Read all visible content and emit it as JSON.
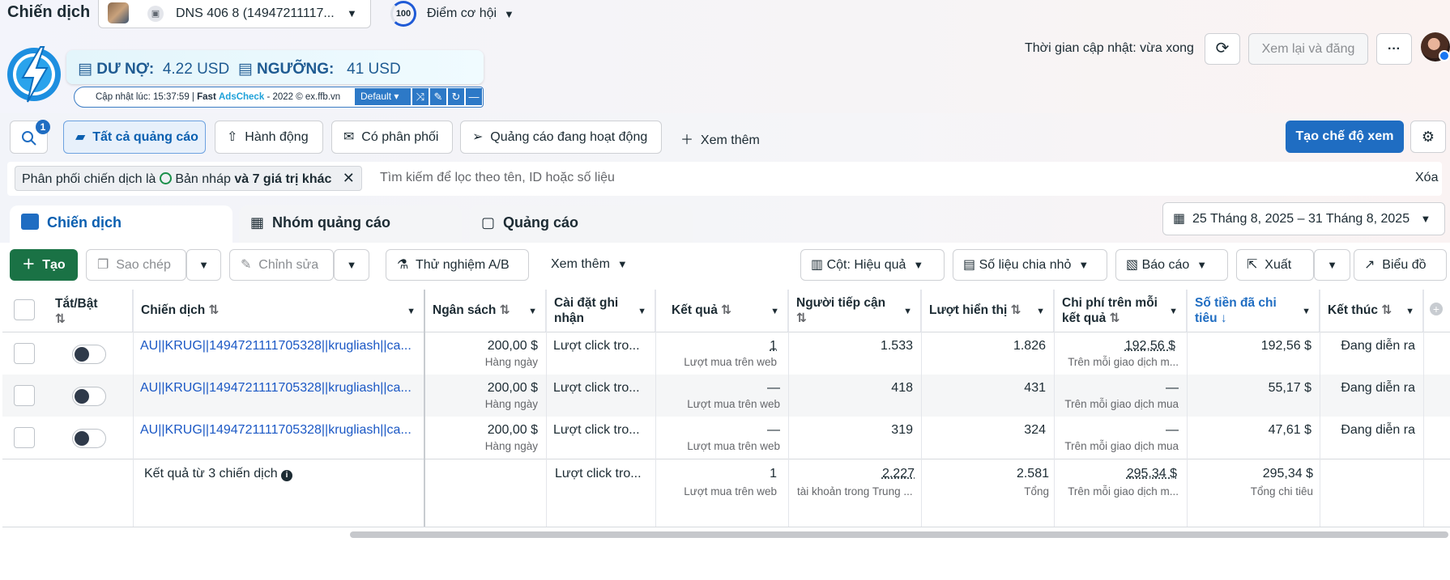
{
  "header": {
    "title": "Chiến dịch",
    "account_name": "DNS 406 8 (14947211117...",
    "opportunity_score": "100",
    "opportunity_label": "Điểm cơ hội",
    "update_time": "Thời gian cập nhật: vừa xong",
    "review_publish": "Xem lại và đăng",
    "more": "···"
  },
  "adscheck": {
    "debt_label": "DƯ NỢ:",
    "debt_value": "4.22 USD",
    "threshold_label": "NGƯỠNG:",
    "threshold_value": "41 USD",
    "updated": "Cập nhật lúc: 15:37:59 |",
    "fast": "Fast",
    "brand": "AdsCheck",
    "copyright": "- 2022 © ex.ffb.vn",
    "preset": "Default"
  },
  "filters": {
    "search_badge": "1",
    "tabs": [
      "Tất cả quảng cáo",
      "Hành động",
      "Có phân phối",
      "Quảng cáo đang hoạt động",
      "Xem thêm"
    ],
    "create_view": "Tạo chế độ xem",
    "chip_prefix": "Phân phối chiến dịch là",
    "chip_value": "Bản nháp",
    "chip_more": "và 7 giá trị khác",
    "search_placeholder": "Tìm kiếm để lọc theo tên, ID hoặc số liệu",
    "clear": "Xóa"
  },
  "levels": {
    "campaigns": "Chiến dịch",
    "adsets": "Nhóm quảng cáo",
    "ads": "Quảng cáo",
    "date_range": "25 Tháng 8, 2025 – 31 Tháng 8, 2025"
  },
  "toolbar": {
    "create": "Tạo",
    "copy": "Sao chép",
    "edit": "Chỉnh sửa",
    "ab_test": "Thử nghiệm A/B",
    "more": "Xem thêm",
    "columns": "Cột: Hiệu quả",
    "breakdown": "Số liệu chia nhỏ",
    "reports": "Báo cáo",
    "export": "Xuất",
    "charts": "Biểu đồ"
  },
  "table": {
    "headers": {
      "toggle": "Tắt/Bật",
      "campaign": "Chiến dịch",
      "budget": "Ngân sách",
      "attribution_1": "Cài đặt ghi",
      "attribution_2": "nhận",
      "results": "Kết quả",
      "reach": "Người tiếp cận",
      "impressions": "Lượt hiển thị",
      "cpr_1": "Chi phí trên mỗi",
      "cpr_2": "kết quả",
      "spent_1": "Số tiền đã chi",
      "spent_2": "tiêu",
      "ends": "Kết thúc"
    },
    "rows": [
      {
        "name": "AU||KRUG||1494721111705328||krugliash||ca...",
        "budget": "200,00 $",
        "budget_sub": "Hàng ngày",
        "attribution": "Lượt click tro...",
        "result": "1",
        "result_sub": "Lượt mua trên web",
        "reach": "1.533",
        "impressions": "1.826",
        "cpr": "192,56 $",
        "cpr_sub": "Trên mỗi giao dịch m...",
        "spent": "192,56 $",
        "ends": "Đang diễn ra"
      },
      {
        "name": "AU||KRUG||1494721111705328||krugliash||ca...",
        "budget": "200,00 $",
        "budget_sub": "Hàng ngày",
        "attribution": "Lượt click tro...",
        "result": "—",
        "result_sub": "Lượt mua trên web",
        "reach": "418",
        "impressions": "431",
        "cpr": "—",
        "cpr_sub": "Trên mỗi giao dịch mua",
        "spent": "55,17 $",
        "ends": "Đang diễn ra"
      },
      {
        "name": "AU||KRUG||1494721111705328||krugliash||ca...",
        "budget": "200,00 $",
        "budget_sub": "Hàng ngày",
        "attribution": "Lượt click tro...",
        "result": "—",
        "result_sub": "Lượt mua trên web",
        "reach": "319",
        "impressions": "324",
        "cpr": "—",
        "cpr_sub": "Trên mỗi giao dịch mua",
        "spent": "47,61 $",
        "ends": "Đang diễn ra"
      }
    ],
    "totals": {
      "label": "Kết quả từ 3 chiến dịch",
      "attribution": "Lượt click tro...",
      "result": "1",
      "result_sub": "Lượt mua trên web",
      "reach": "2.227",
      "reach_sub": "tài khoản trong Trung ...",
      "impressions": "2.581",
      "impressions_sub": "Tổng",
      "cpr": "295,34 $",
      "cpr_sub": "Trên mỗi giao dịch m...",
      "spent": "295,34 $",
      "spent_sub": "Tổng chi tiêu"
    }
  }
}
